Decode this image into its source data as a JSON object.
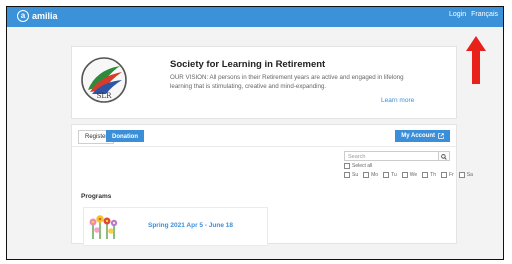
{
  "topbar": {
    "brand": "amilia",
    "login_label": "Login",
    "language_label": "Français",
    "bar_color": "#3b92d8"
  },
  "organization": {
    "name": "Society for Learning in Retirement",
    "description": "OUR VISION: All persons in their Retirement years are active and engaged in lifelong learning that is stimulating, creative and mind-expanding.",
    "learn_more": "Learn more",
    "logo_text": "SLR"
  },
  "tabs": [
    {
      "label": "Register",
      "active": true
    },
    {
      "label": "Donation",
      "active": false
    }
  ],
  "my_account_label": "My Account",
  "search": {
    "placeholder": "Search",
    "select_all": "Select all",
    "days": [
      "Su",
      "Mo",
      "Tu",
      "We",
      "Th",
      "Fr",
      "Sa"
    ]
  },
  "programs": {
    "heading": "Programs",
    "items": [
      {
        "name": "Spring 2021 Apr 5 - June 18",
        "image": "flowers-image"
      }
    ]
  },
  "annotation": {
    "arrow_color": "#e8211b",
    "icon": "up-arrow"
  },
  "accent_color": "#3b8fd9"
}
